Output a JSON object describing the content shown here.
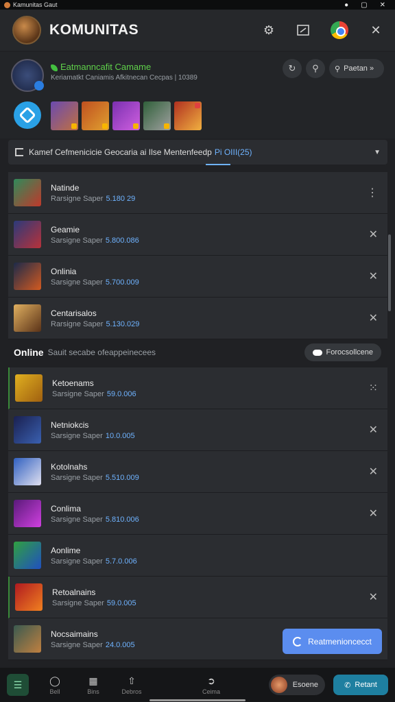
{
  "statusbar": {
    "title": "Kamunitas Gaut"
  },
  "header": {
    "title": "KOMUNITAS"
  },
  "community": {
    "name": "Eatmanncafit Camame",
    "subtitle": "Keriamatkt Caniamis Afkitnecan Cecpas | 10389",
    "search_label": "Paetan »"
  },
  "filter": {
    "text": "Kamef Cefmenicicie Geocaria ai Ilse Mentenfeedp",
    "accent": "Pi OIII(25)"
  },
  "list1": [
    {
      "title": "Natinde",
      "sub": "Rarsigne Saper",
      "amount": "5.180 29",
      "action": "⋮",
      "color1": "#2f8a5a",
      "color2": "#c0392b"
    },
    {
      "title": "Geamie",
      "sub": "Sarsigne Saper",
      "amount": "5.800.086",
      "action": "✕",
      "color1": "#2b3a7a",
      "color2": "#b8323a"
    },
    {
      "title": "Onlinia",
      "sub": "Sarsigne Saper",
      "amount": "5.700.009",
      "action": "✕",
      "color1": "#1c2a4a",
      "color2": "#d35a20"
    },
    {
      "title": "Centarisalos",
      "sub": "Rarsigne Saper",
      "amount": "5.130.029",
      "action": "✕",
      "color1": "#e0b060",
      "color2": "#5a3218"
    }
  ],
  "online": {
    "title": "Online",
    "subtitle": "Sauit secabe ofeappeinecees",
    "pill": "Forocsollcene"
  },
  "list2": [
    {
      "title": "Ketoenams",
      "sub": "Sarsigne Saper",
      "amount": "59.0.006",
      "action": "⁙",
      "color1": "#e0b020",
      "color2": "#a06010"
    },
    {
      "title": "Netniokcis",
      "sub": "Sarsigne Saper",
      "amount": "10.0.005",
      "action": "✕",
      "color1": "#1a2050",
      "color2": "#3a60b0"
    },
    {
      "title": "Kotolnahs",
      "sub": "Sarsigne Saper",
      "amount": "5.510.009",
      "action": "✕",
      "color1": "#3060c0",
      "color2": "#e0e0f0"
    },
    {
      "title": "Conlima",
      "sub": "Sarsigne Saper",
      "amount": "5.810.006",
      "action": "✕",
      "color1": "#5a1a7a",
      "color2": "#d040e0"
    },
    {
      "title": "Aonlime",
      "sub": "Sarsigne Saper",
      "amount": "5.7.0.006",
      "action": "",
      "color1": "#30a040",
      "color2": "#2050c0"
    },
    {
      "title": "Retoalnains",
      "sub": "Sarsigne Saper",
      "amount": "59.0.005",
      "action": "✕",
      "color1": "#b01a20",
      "color2": "#f08020"
    },
    {
      "title": "Nocsaimains",
      "sub": "Sarsigne Saper",
      "amount": "24.0.005",
      "action": "",
      "color1": "#3a5a50",
      "color2": "#c08040"
    }
  ],
  "fab": {
    "label": "Reatmenioncecct"
  },
  "bottom": {
    "nav": [
      {
        "label": "Bell"
      },
      {
        "label": "Bins"
      },
      {
        "label": "Debros"
      },
      {
        "label": "Ceima"
      }
    ],
    "user_label": "Esoene",
    "call_label": "Retant"
  }
}
